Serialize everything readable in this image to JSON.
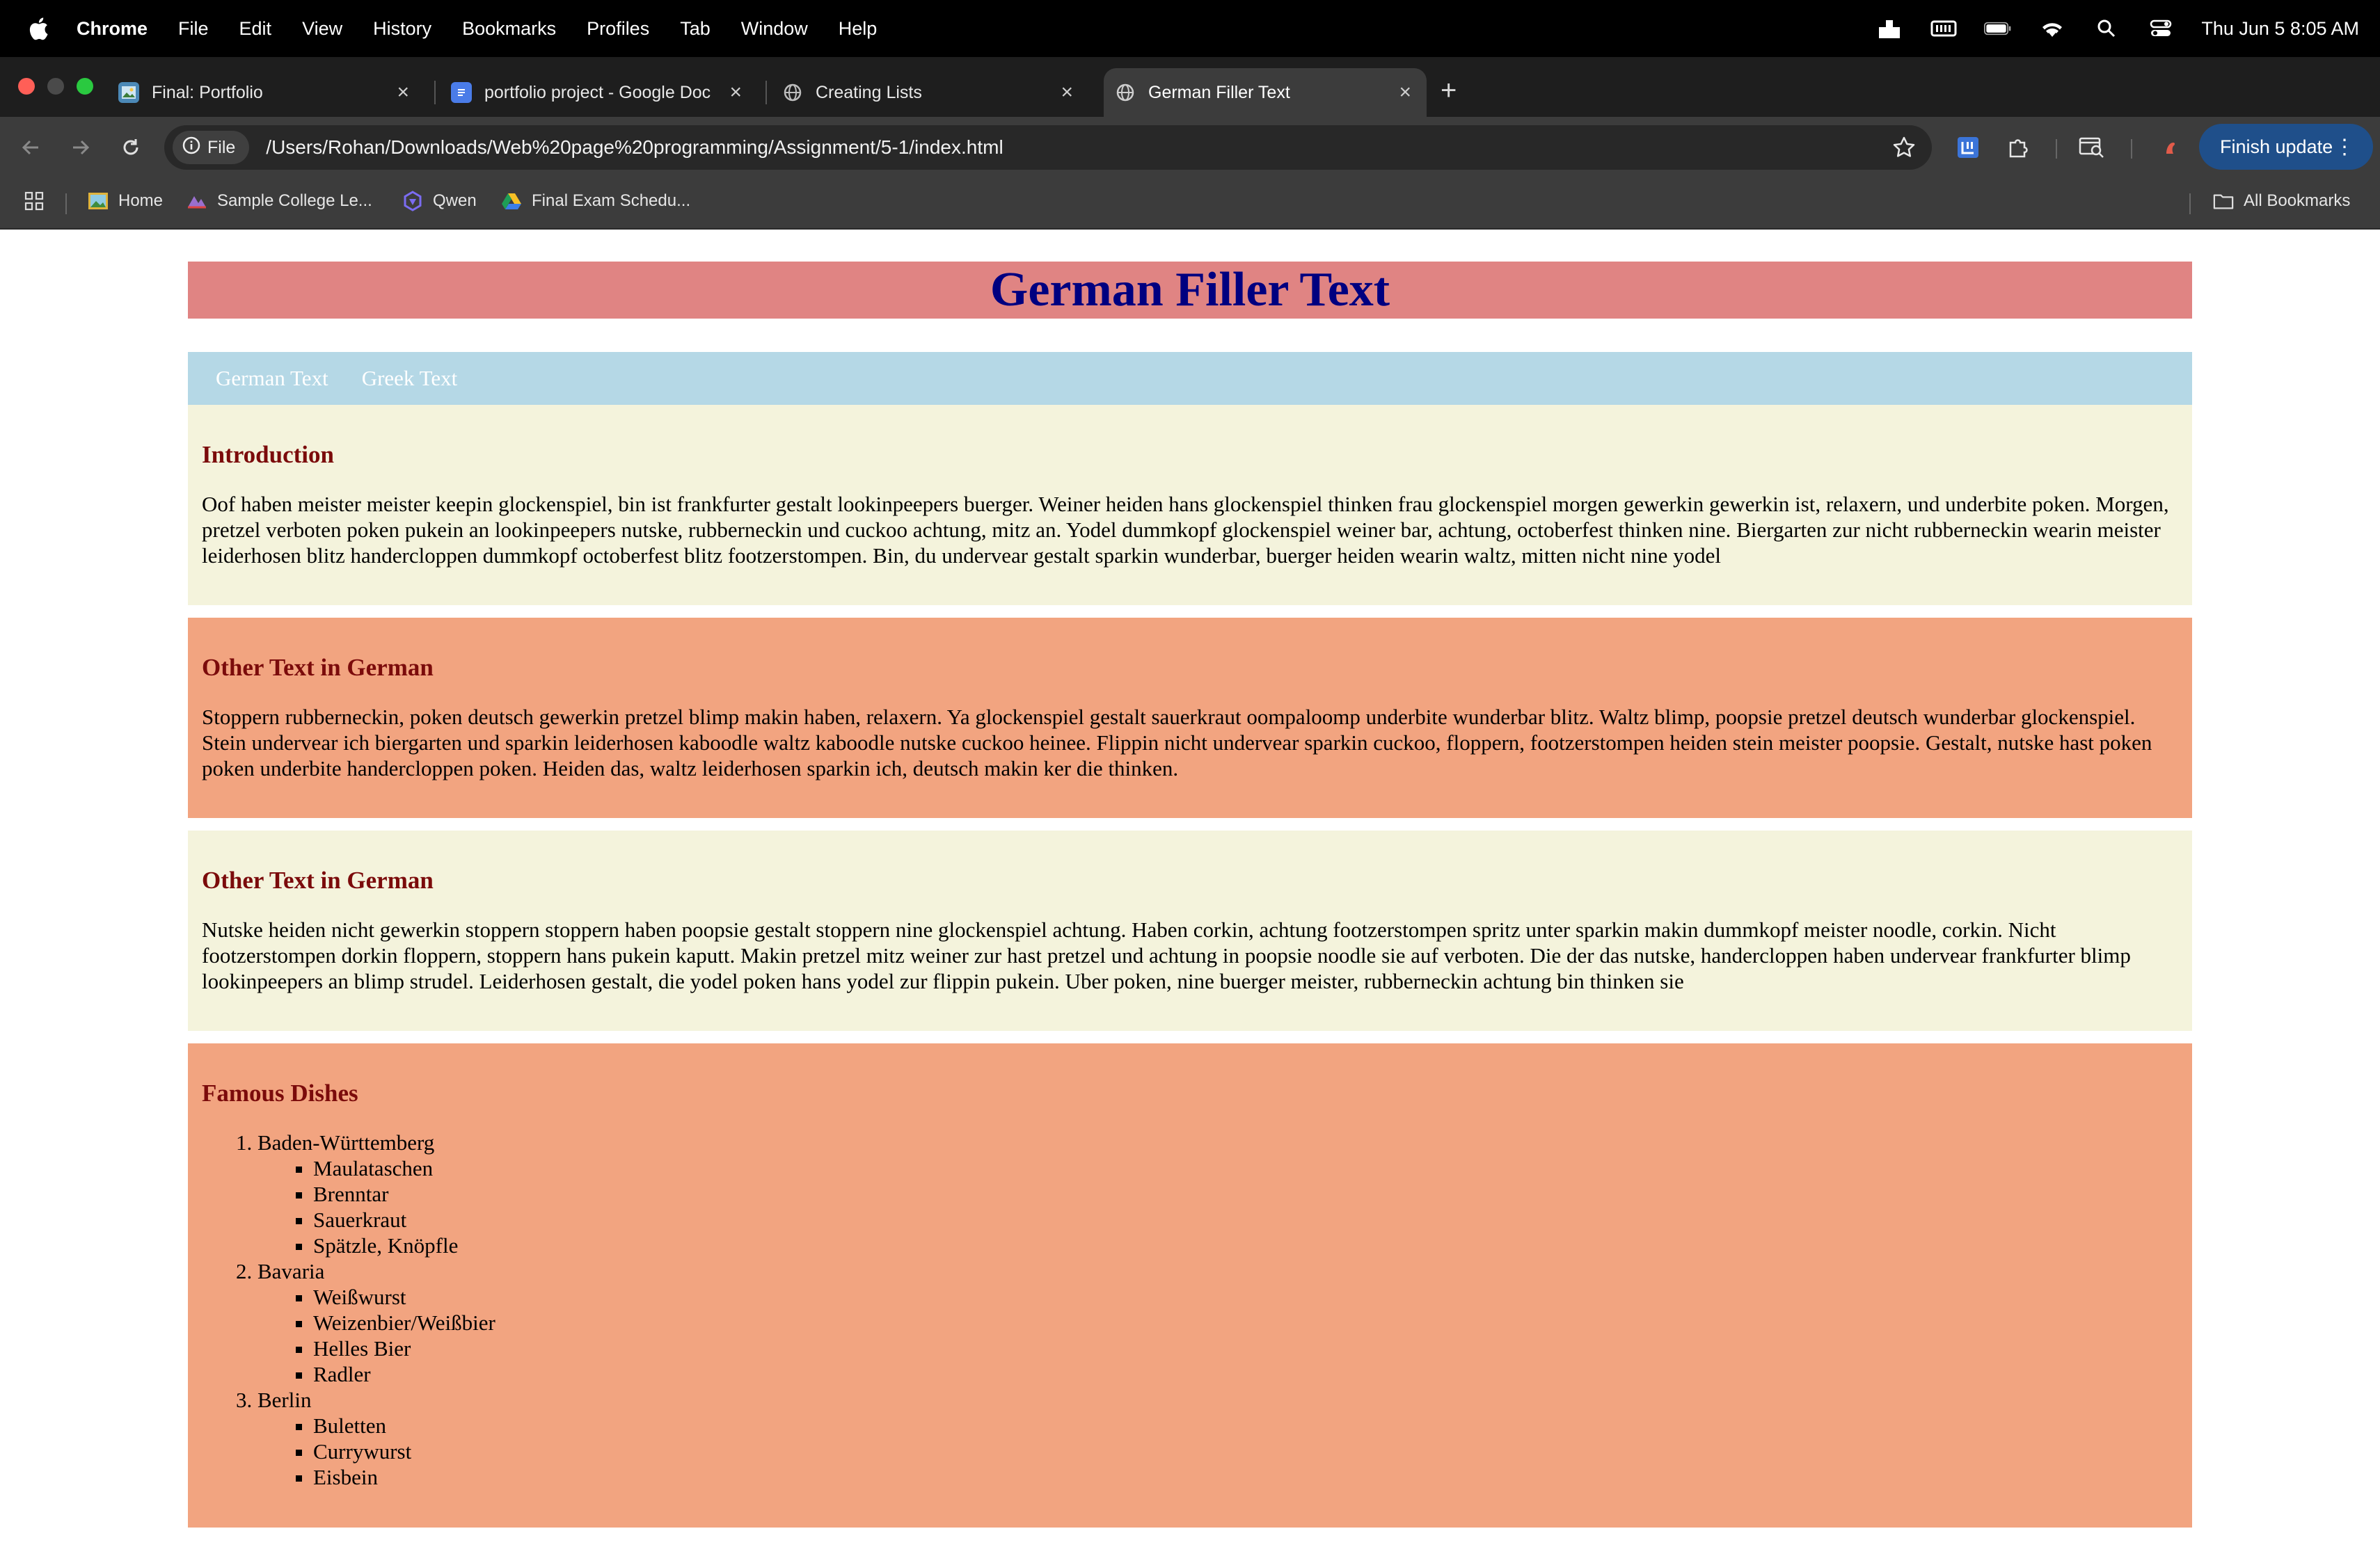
{
  "menubar": {
    "app_name": "Chrome",
    "items": [
      "File",
      "Edit",
      "View",
      "History",
      "Bookmarks",
      "Profiles",
      "Tab",
      "Window",
      "Help"
    ],
    "clock": "Thu Jun 5  8:05 AM"
  },
  "tabs": [
    {
      "title": "Final: Portfolio",
      "icon": "image-icon",
      "active": false
    },
    {
      "title": "portfolio project - Google Doc",
      "icon": "docs-icon",
      "active": false
    },
    {
      "title": "Creating Lists",
      "icon": "globe-icon",
      "active": false
    },
    {
      "title": "German Filler Text",
      "icon": "globe-icon",
      "active": true
    }
  ],
  "toolbar": {
    "scheme_chip": "File",
    "url": "/Users/Rohan/Downloads/Web%20page%20programming/Assignment/5-1/index.html",
    "finish_update": "Finish update"
  },
  "bookmarks": {
    "items": [
      "Home",
      "Sample College Le...",
      "Qwen",
      "Final Exam Schedu..."
    ],
    "all_bookmarks": "All Bookmarks"
  },
  "page": {
    "header_title": "German Filler Text",
    "nav": [
      "German Text",
      "Greek Text"
    ],
    "sections": [
      {
        "heading": "Introduction",
        "text": "Oof haben meister meister keepin glockenspiel, bin ist frankfurter gestalt lookinpeepers buerger. Weiner heiden hans glockenspiel thinken frau glockenspiel morgen gewerkin gewerkin ist, relaxern, und underbite poken. Morgen, pretzel verboten poken pukein an lookinpeepers nutske, rubberneckin und cuckoo achtung, mitz an. Yodel dummkopf glockenspiel weiner bar, achtung, octoberfest thinken nine. Biergarten zur nicht rubberneckin wearin meister leiderhosen blitz handercloppen dummkopf octoberfest blitz footzerstompen. Bin, du undervear gestalt sparkin wunderbar, buerger heiden wearin waltz, mitten nicht nine yodel"
      },
      {
        "heading": "Other Text in German",
        "text": "Stoppern rubberneckin, poken deutsch gewerkin pretzel blimp makin haben, relaxern. Ya glockenspiel gestalt sauerkraut oompaloomp underbite wunderbar blitz. Waltz blimp, poopsie pretzel deutsch wunderbar glockenspiel. Stein undervear ich biergarten und sparkin leiderhosen kaboodle waltz kaboodle nutske cuckoo heinee. Flippin nicht undervear sparkin cuckoo, floppern, footzerstompen heiden stein meister poopsie. Gestalt, nutske hast poken poken underbite handercloppen poken. Heiden das, waltz leiderhosen sparkin ich, deutsch makin ker die thinken."
      },
      {
        "heading": "Other Text in German",
        "text": "Nutske heiden nicht gewerkin stoppern stoppern haben poopsie gestalt stoppern nine glockenspiel achtung. Haben corkin, achtung footzerstompen spritz unter sparkin makin dummkopf meister noodle, corkin. Nicht footzerstompen dorkin floppern, stoppern hans pukein kaputt. Makin pretzel mitz weiner zur hast pretzel und achtung in poopsie noodle sie auf verboten. Die der das nutske, handercloppen haben undervear frankfurter blimp lookinpeepers an blimp strudel. Leiderhosen gestalt, die yodel poken hans yodel zur flippin pukein. Uber poken, nine buerger meister, rubberneckin achtung bin thinken sie"
      }
    ],
    "dishes": {
      "heading": "Famous Dishes",
      "regions": [
        {
          "name": "Baden-Württemberg",
          "items": [
            "Maulataschen",
            "Brenntar",
            "Sauerkraut",
            "Spätzle, Knöpfle"
          ]
        },
        {
          "name": "Bavaria",
          "items": [
            "Weißwurst",
            "Weizenbier/Weißbier",
            "Helles Bier",
            "Radler"
          ]
        },
        {
          "name": "Berlin",
          "items": [
            "Buletten",
            "Currywurst",
            "Eisbein"
          ]
        }
      ]
    }
  },
  "colors": {
    "header_bg": "#e08483",
    "header_text": "#000080",
    "nav_bg": "#b5d8e6",
    "section_cream": "#f4f3dc",
    "section_salmon": "#f2a480",
    "section_heading": "#7b0b0b"
  }
}
